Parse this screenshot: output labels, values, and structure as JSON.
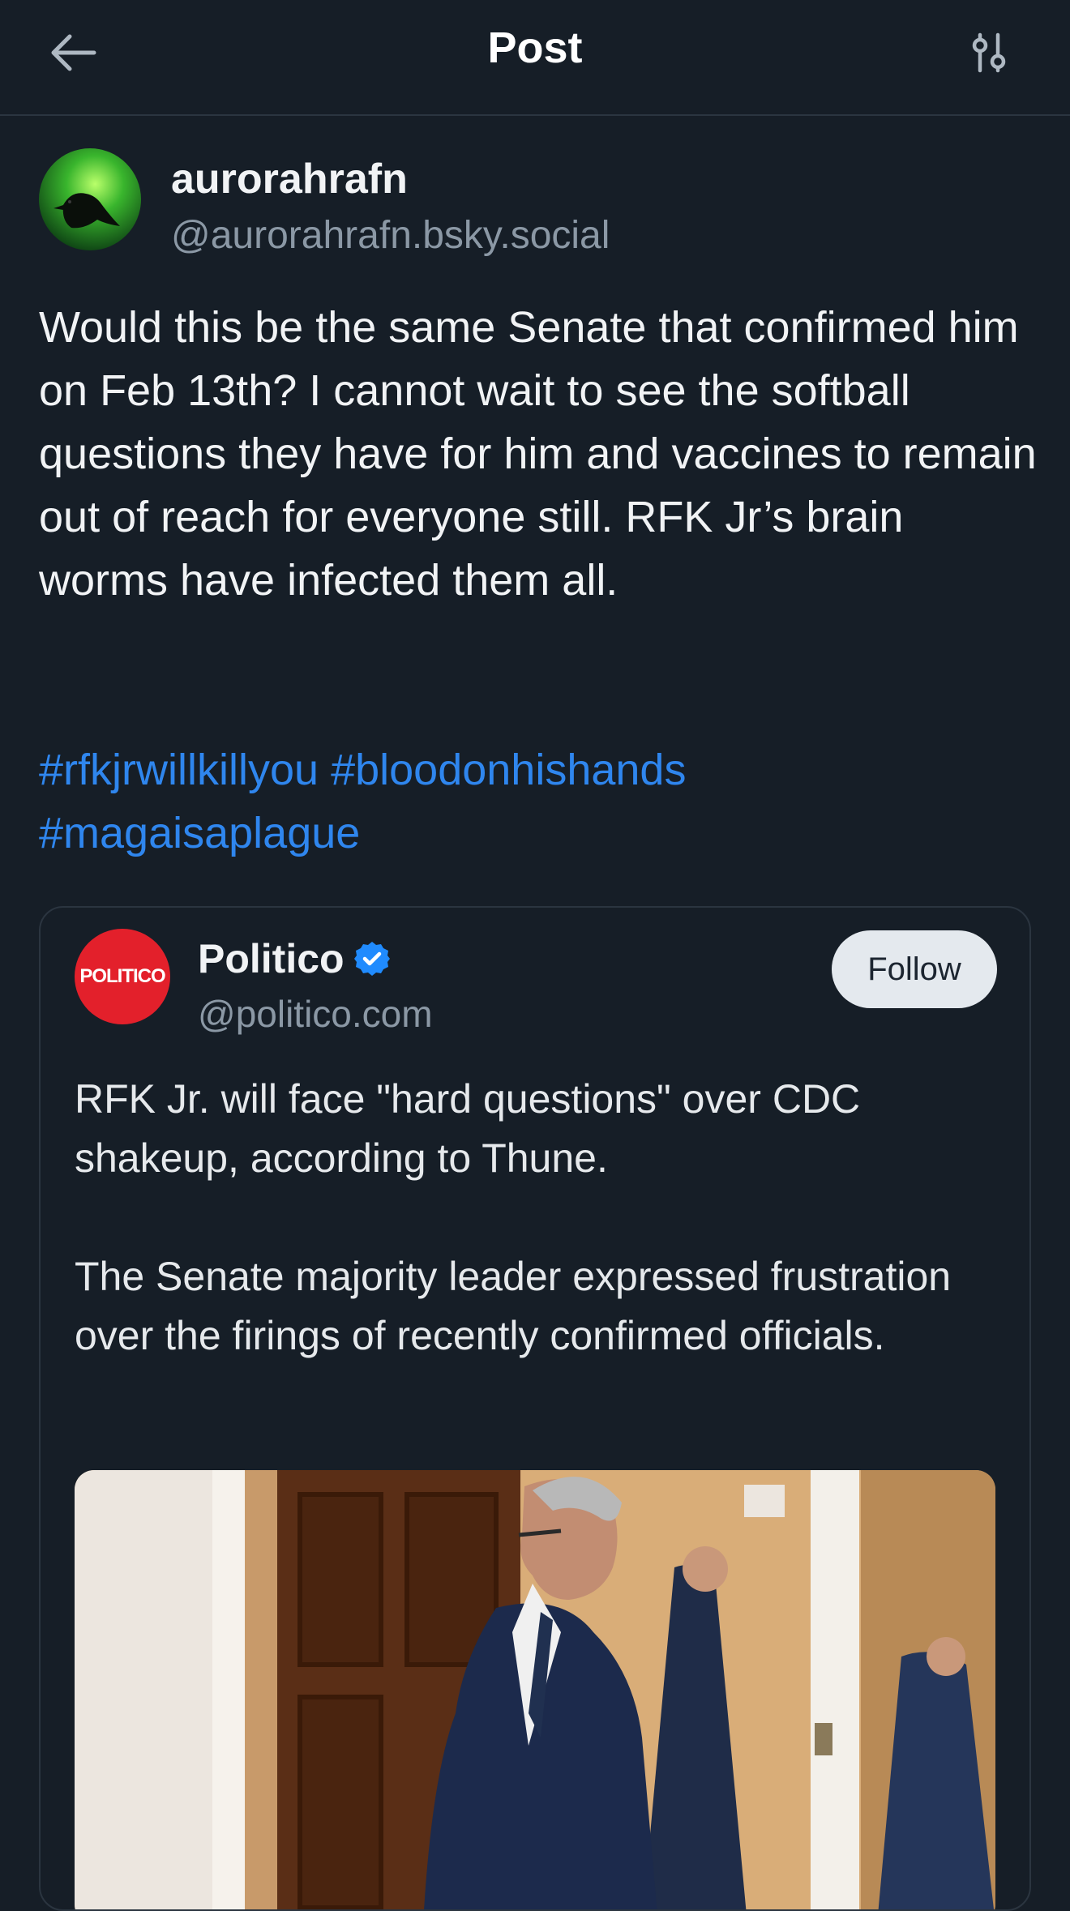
{
  "header": {
    "title": "Post",
    "back_icon": "arrow-left-icon",
    "settings_icon": "sliders-icon"
  },
  "post": {
    "author": {
      "display_name": "aurorahrafn",
      "handle": "@aurorahrafn.bsky.social",
      "avatar_icon": "raven-aurora-avatar"
    },
    "text": "Would this be the same Senate that confirmed him on Feb 13th? I cannot wait to see the softball questions they have for him and vaccines to remain out of reach for everyone still. RFK Jr’s brain worms have infected them all.",
    "hashtags": [
      "#rfkjrwillkillyou",
      "#bloodonhishands",
      "#magaisaplague"
    ]
  },
  "quote": {
    "avatar_text": "POLITICO",
    "display_name": "Politico",
    "verified_icon": "verified-check-icon",
    "handle": "@politico.com",
    "follow_label": "Follow",
    "text": "RFK Jr. will face \"hard questions\" over CDC shakeup, according to Thune.\n\nThe Senate majority leader expressed frustration over the firings of recently confirmed officials.",
    "image_icon": "senate-hallway-photo"
  },
  "colors": {
    "background": "#161e27",
    "link": "#2f86ee",
    "muted": "#8b98a5",
    "politico_red": "#e3202b",
    "verified_blue": "#208bfe"
  }
}
